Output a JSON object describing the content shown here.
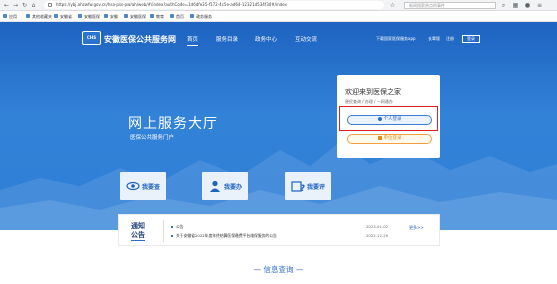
{
  "browser": {
    "url": "https://ybj.ahzwfw.gov.cn/hsa-pss-pw/ah/web/#/index?authCode=1d6dfe35-f172-4c5e-ad64-12321d534f30#/index",
    "search_placeholder": "新闻搜索热点的事件"
  },
  "bookmarks": [
    "应用",
    "其他收藏夹",
    "安徽省",
    "安徽医保",
    "安徽",
    "安徽医保",
    "教育",
    "首页",
    "政务服务"
  ],
  "header": {
    "logo_text": "CHS",
    "site_name": "安徽医保公共服务网",
    "nav": [
      "首页",
      "服务目录",
      "政务中心",
      "互动交流"
    ],
    "links": [
      "下载国家医保服务app",
      "长辈版"
    ],
    "register": "注册",
    "login": "登录"
  },
  "hero": {
    "title": "网上服务大厅",
    "subtitle": "医保公共服务门户"
  },
  "login_card": {
    "welcome": "欢迎来到医保之家",
    "tagline": "便民查询 / 办理 / 一网通办",
    "personal_login": "个人登录",
    "unit_login": "单位登录"
  },
  "services": [
    {
      "label": "我要查",
      "icon": "eye-icon"
    },
    {
      "label": "我要办",
      "icon": "person-icon"
    },
    {
      "label": "我要评",
      "icon": "question-icon"
    }
  ],
  "notice": {
    "tag_line1": "通知",
    "tag_line2": "公告",
    "items": [
      {
        "title": "公告",
        "date": "2023-01-02"
      },
      {
        "title": "关于安徽省2022年度年终结算医保缴费平台维保服务的公告",
        "date": "2022-12-29"
      }
    ],
    "more": "更多>>"
  },
  "info_query": "— 信息查询 —",
  "colors": {
    "primary": "#1e63c0",
    "highlight": "#e02020",
    "unit_accent": "#e0901a"
  }
}
